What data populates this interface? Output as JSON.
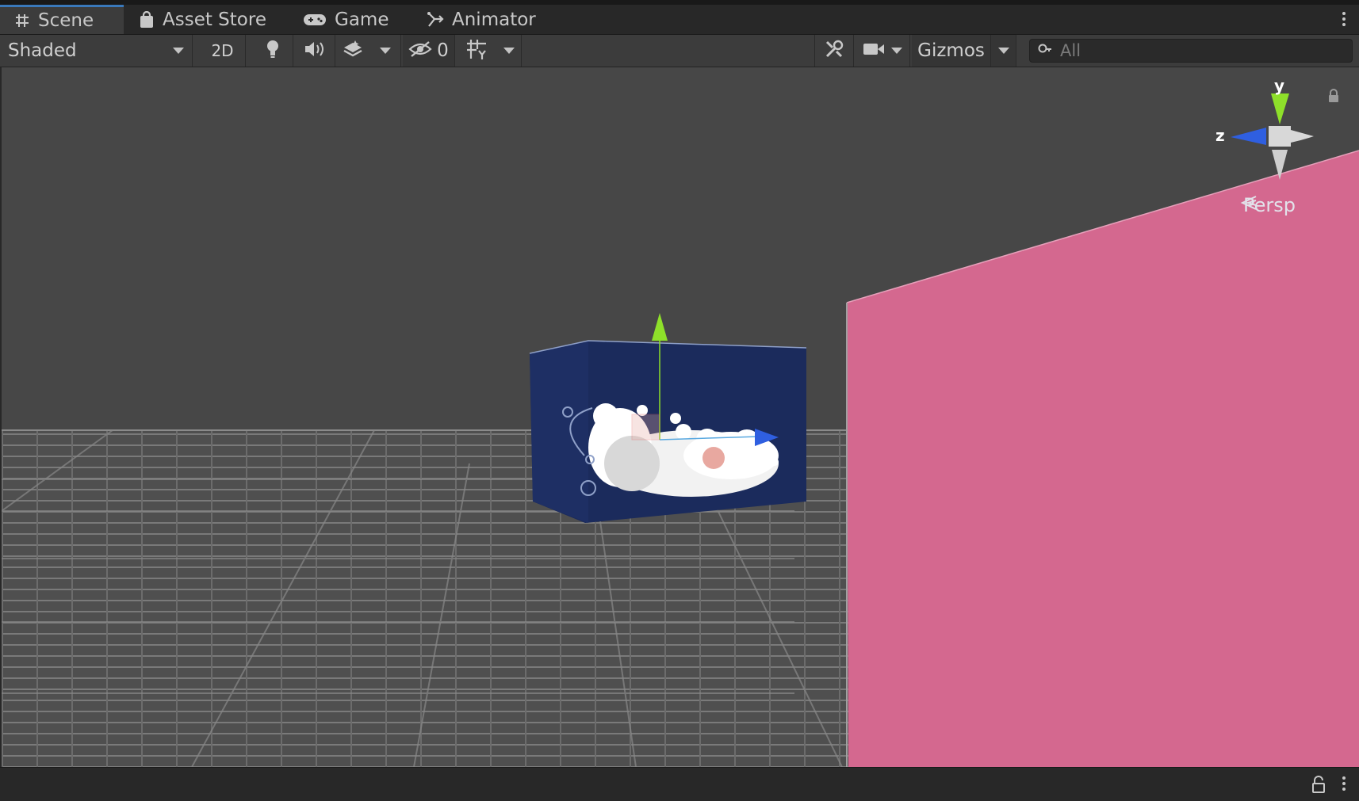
{
  "tabs": [
    {
      "label": "Scene",
      "icon": "grid-hash-icon",
      "active": true
    },
    {
      "label": "Asset Store",
      "icon": "shopping-bag-icon",
      "active": false
    },
    {
      "label": "Game",
      "icon": "gamepad-icon",
      "active": false
    },
    {
      "label": "Animator",
      "icon": "animator-icon",
      "active": false
    }
  ],
  "toolbar": {
    "draw_mode": "Shaded",
    "toggle_2d": "2D",
    "hidden_count": "0",
    "gizmos_label": "Gizmos",
    "search_placeholder": "All"
  },
  "scene": {
    "projection_label": "Persp",
    "axis_labels": {
      "y": "y",
      "z": "z"
    },
    "colors": {
      "background": "#474747",
      "ground": "#555555",
      "box": "#1b2b5c",
      "wall": "#d4688f",
      "axis_y": "#8ee02a",
      "axis_z": "#2f5fe0"
    }
  }
}
